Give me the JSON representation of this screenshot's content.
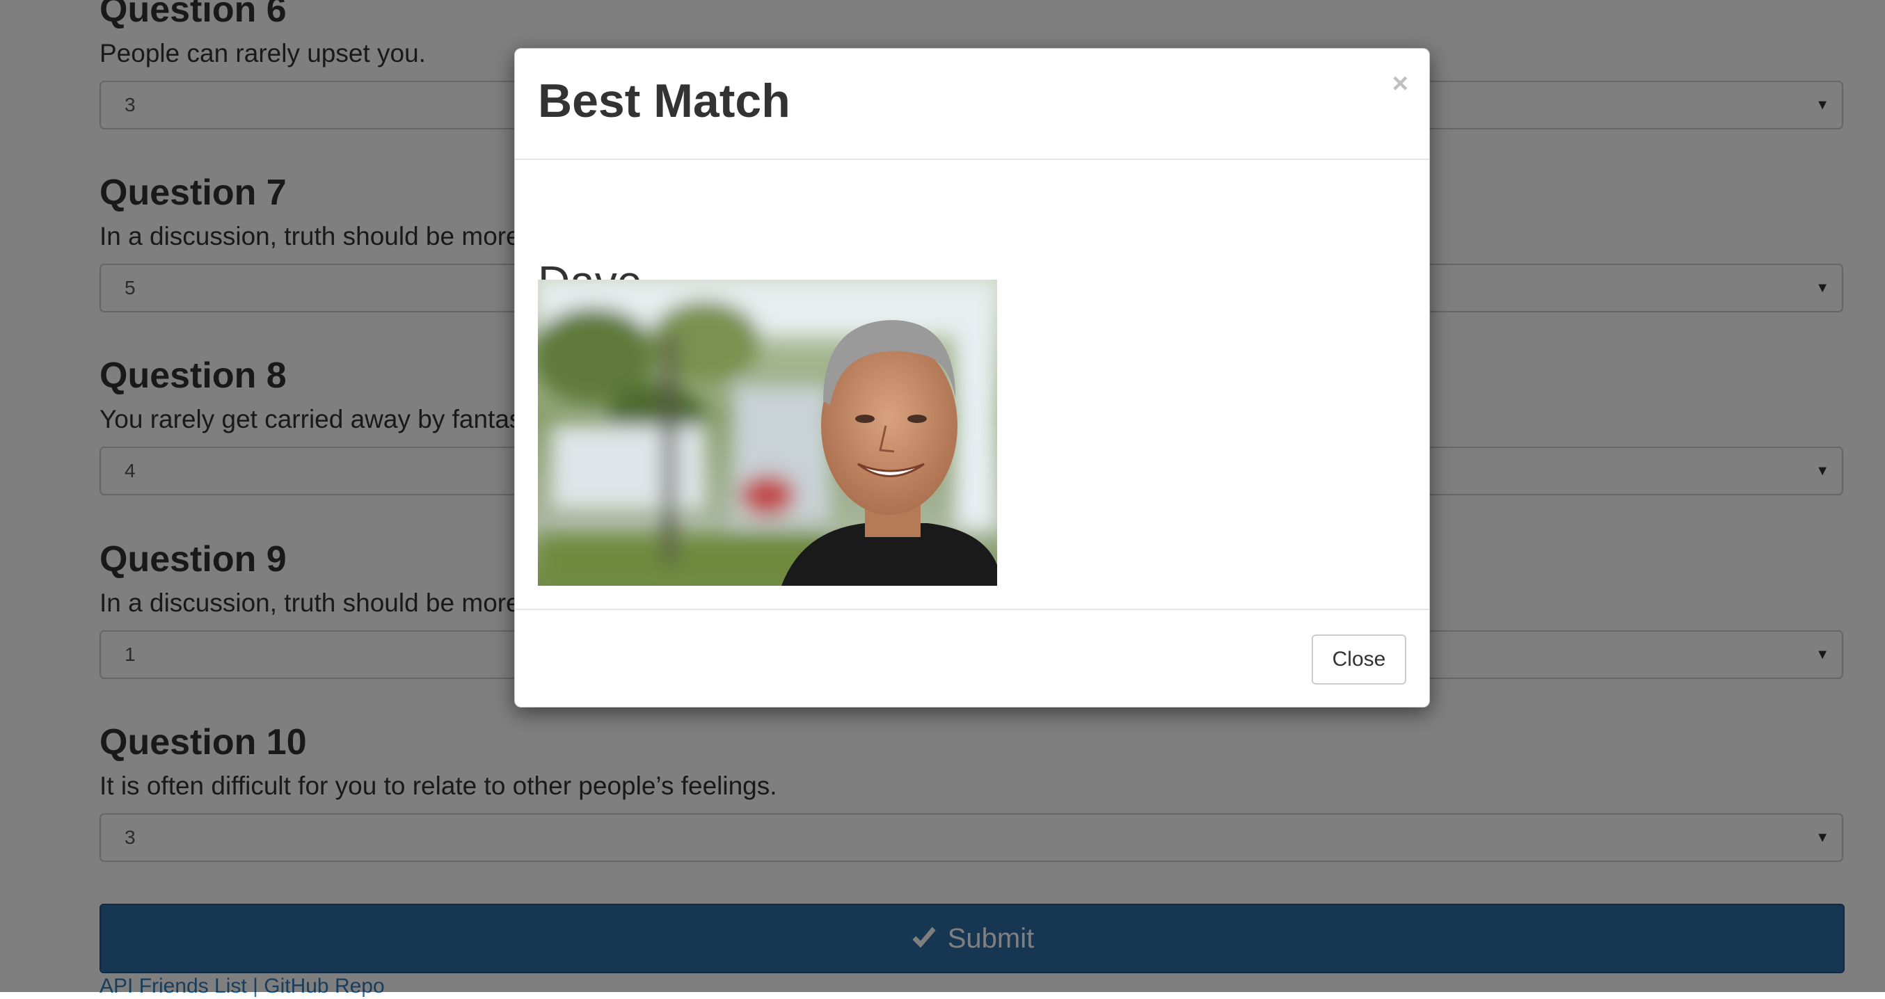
{
  "questions": [
    {
      "title": "Question 6",
      "text": "People can rarely upset you.",
      "selected": "3"
    },
    {
      "title": "Question 7",
      "text": "In a discussion, truth should be more important than considering other people’s feelings.",
      "selected": "5"
    },
    {
      "title": "Question 8",
      "text": "You rarely get carried away by fantasies and ideas.",
      "selected": "4"
    },
    {
      "title": "Question 9",
      "text": "In a discussion, truth should be more important than considering other people’s feelings.",
      "selected": "1"
    },
    {
      "title": "Question 10",
      "text": "It is often difficult for you to relate to other people’s feelings.",
      "selected": "3"
    }
  ],
  "submit": {
    "label": "Submit",
    "icon": "check-icon"
  },
  "footer": {
    "api_link": "API Friends List",
    "separator": "|",
    "github_link": "GitHub Repo"
  },
  "modal": {
    "title": "Best Match",
    "close_x": "×",
    "match_name": "Dave",
    "close_button": "Close"
  },
  "colors": {
    "submit_bg": "#2e6da4",
    "backdrop": "rgba(0,0,0,0.5)",
    "link": "#337ab7"
  }
}
